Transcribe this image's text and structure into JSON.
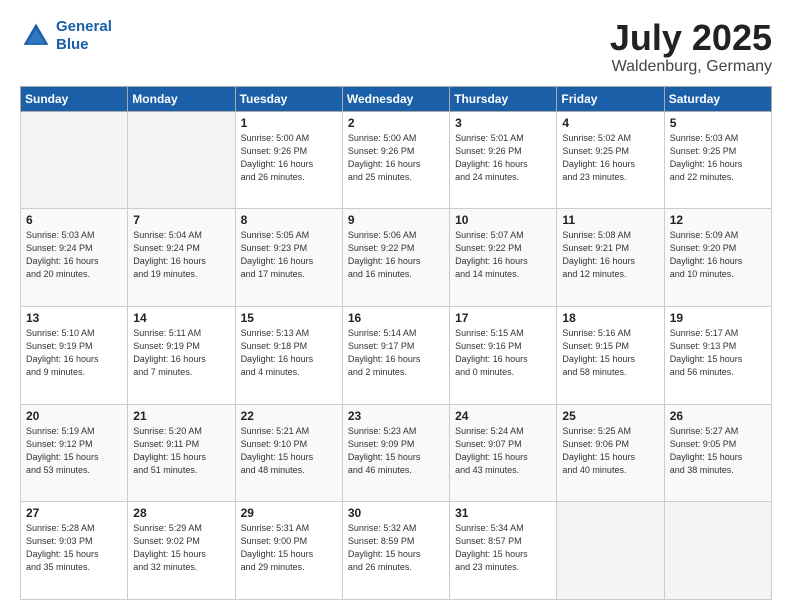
{
  "header": {
    "logo_line1": "General",
    "logo_line2": "Blue",
    "month": "July 2025",
    "location": "Waldenburg, Germany"
  },
  "weekdays": [
    "Sunday",
    "Monday",
    "Tuesday",
    "Wednesday",
    "Thursday",
    "Friday",
    "Saturday"
  ],
  "weeks": [
    [
      {
        "day": "",
        "info": ""
      },
      {
        "day": "",
        "info": ""
      },
      {
        "day": "1",
        "info": "Sunrise: 5:00 AM\nSunset: 9:26 PM\nDaylight: 16 hours\nand 26 minutes."
      },
      {
        "day": "2",
        "info": "Sunrise: 5:00 AM\nSunset: 9:26 PM\nDaylight: 16 hours\nand 25 minutes."
      },
      {
        "day": "3",
        "info": "Sunrise: 5:01 AM\nSunset: 9:26 PM\nDaylight: 16 hours\nand 24 minutes."
      },
      {
        "day": "4",
        "info": "Sunrise: 5:02 AM\nSunset: 9:25 PM\nDaylight: 16 hours\nand 23 minutes."
      },
      {
        "day": "5",
        "info": "Sunrise: 5:03 AM\nSunset: 9:25 PM\nDaylight: 16 hours\nand 22 minutes."
      }
    ],
    [
      {
        "day": "6",
        "info": "Sunrise: 5:03 AM\nSunset: 9:24 PM\nDaylight: 16 hours\nand 20 minutes."
      },
      {
        "day": "7",
        "info": "Sunrise: 5:04 AM\nSunset: 9:24 PM\nDaylight: 16 hours\nand 19 minutes."
      },
      {
        "day": "8",
        "info": "Sunrise: 5:05 AM\nSunset: 9:23 PM\nDaylight: 16 hours\nand 17 minutes."
      },
      {
        "day": "9",
        "info": "Sunrise: 5:06 AM\nSunset: 9:22 PM\nDaylight: 16 hours\nand 16 minutes."
      },
      {
        "day": "10",
        "info": "Sunrise: 5:07 AM\nSunset: 9:22 PM\nDaylight: 16 hours\nand 14 minutes."
      },
      {
        "day": "11",
        "info": "Sunrise: 5:08 AM\nSunset: 9:21 PM\nDaylight: 16 hours\nand 12 minutes."
      },
      {
        "day": "12",
        "info": "Sunrise: 5:09 AM\nSunset: 9:20 PM\nDaylight: 16 hours\nand 10 minutes."
      }
    ],
    [
      {
        "day": "13",
        "info": "Sunrise: 5:10 AM\nSunset: 9:19 PM\nDaylight: 16 hours\nand 9 minutes."
      },
      {
        "day": "14",
        "info": "Sunrise: 5:11 AM\nSunset: 9:19 PM\nDaylight: 16 hours\nand 7 minutes."
      },
      {
        "day": "15",
        "info": "Sunrise: 5:13 AM\nSunset: 9:18 PM\nDaylight: 16 hours\nand 4 minutes."
      },
      {
        "day": "16",
        "info": "Sunrise: 5:14 AM\nSunset: 9:17 PM\nDaylight: 16 hours\nand 2 minutes."
      },
      {
        "day": "17",
        "info": "Sunrise: 5:15 AM\nSunset: 9:16 PM\nDaylight: 16 hours\nand 0 minutes."
      },
      {
        "day": "18",
        "info": "Sunrise: 5:16 AM\nSunset: 9:15 PM\nDaylight: 15 hours\nand 58 minutes."
      },
      {
        "day": "19",
        "info": "Sunrise: 5:17 AM\nSunset: 9:13 PM\nDaylight: 15 hours\nand 56 minutes."
      }
    ],
    [
      {
        "day": "20",
        "info": "Sunrise: 5:19 AM\nSunset: 9:12 PM\nDaylight: 15 hours\nand 53 minutes."
      },
      {
        "day": "21",
        "info": "Sunrise: 5:20 AM\nSunset: 9:11 PM\nDaylight: 15 hours\nand 51 minutes."
      },
      {
        "day": "22",
        "info": "Sunrise: 5:21 AM\nSunset: 9:10 PM\nDaylight: 15 hours\nand 48 minutes."
      },
      {
        "day": "23",
        "info": "Sunrise: 5:23 AM\nSunset: 9:09 PM\nDaylight: 15 hours\nand 46 minutes."
      },
      {
        "day": "24",
        "info": "Sunrise: 5:24 AM\nSunset: 9:07 PM\nDaylight: 15 hours\nand 43 minutes."
      },
      {
        "day": "25",
        "info": "Sunrise: 5:25 AM\nSunset: 9:06 PM\nDaylight: 15 hours\nand 40 minutes."
      },
      {
        "day": "26",
        "info": "Sunrise: 5:27 AM\nSunset: 9:05 PM\nDaylight: 15 hours\nand 38 minutes."
      }
    ],
    [
      {
        "day": "27",
        "info": "Sunrise: 5:28 AM\nSunset: 9:03 PM\nDaylight: 15 hours\nand 35 minutes."
      },
      {
        "day": "28",
        "info": "Sunrise: 5:29 AM\nSunset: 9:02 PM\nDaylight: 15 hours\nand 32 minutes."
      },
      {
        "day": "29",
        "info": "Sunrise: 5:31 AM\nSunset: 9:00 PM\nDaylight: 15 hours\nand 29 minutes."
      },
      {
        "day": "30",
        "info": "Sunrise: 5:32 AM\nSunset: 8:59 PM\nDaylight: 15 hours\nand 26 minutes."
      },
      {
        "day": "31",
        "info": "Sunrise: 5:34 AM\nSunset: 8:57 PM\nDaylight: 15 hours\nand 23 minutes."
      },
      {
        "day": "",
        "info": ""
      },
      {
        "day": "",
        "info": ""
      }
    ]
  ]
}
